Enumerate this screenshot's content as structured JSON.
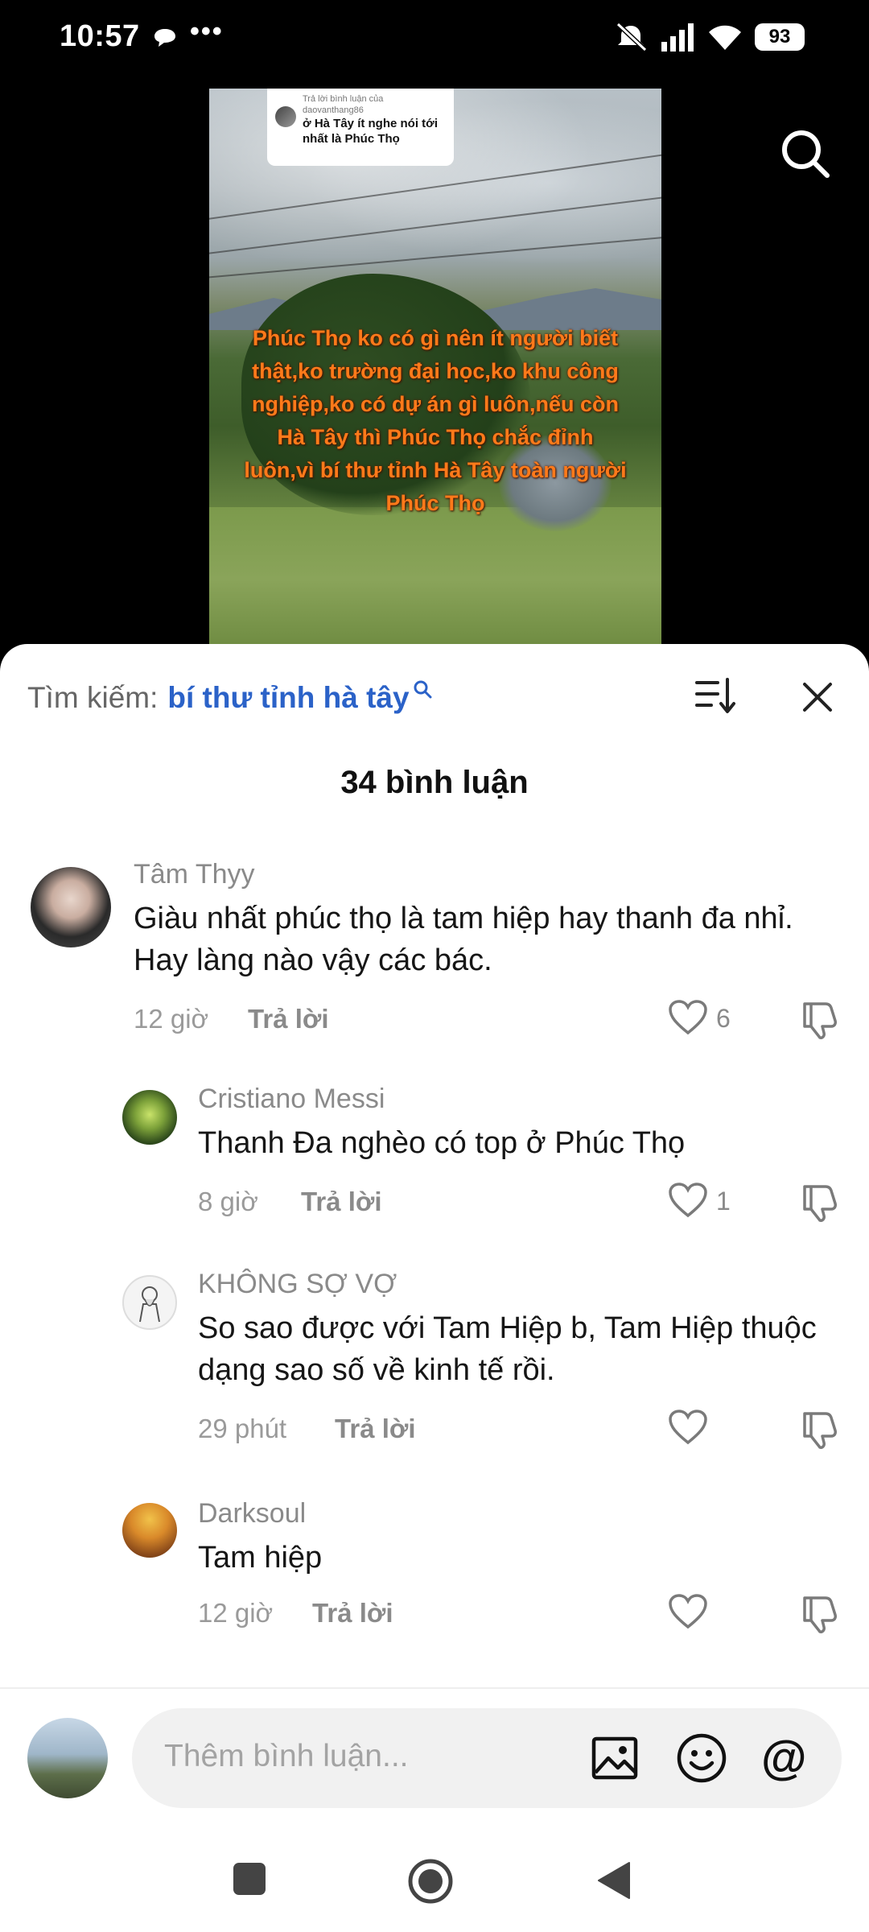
{
  "status_bar": {
    "time": "10:57",
    "more": "•••",
    "battery": "93"
  },
  "video": {
    "reply_label": "Trả lời bình luận của daovanthang86",
    "reply_text": "ở Hà Tây ít nghe nói tới nhất là Phúc Thọ",
    "caption": "Phúc Thọ ko có gì nên ít người biết thật,ko trường đại học,ko khu công nghiệp,ko có dự án gì luôn,nếu còn Hà Tây thì Phúc Thọ chắc đỉnh luôn,vì bí thư tỉnh Hà Tây toàn người Phúc Thọ"
  },
  "sheet": {
    "search_prefix": "Tìm kiếm:",
    "search_keyword": "bí thư tỉnh hà tây",
    "count_label": "34 bình luận"
  },
  "comments": [
    {
      "name": "Tâm Thyy",
      "text": "Giàu nhất phúc thọ là tam hiệp hay thanh đa nhỉ. Hay làng nào vậy các bác.",
      "time": "12 giờ",
      "reply": "Trả lời",
      "likes": "6"
    },
    {
      "name": "Cristiano Messi",
      "text": "Thanh Đa nghèo có top ở Phúc Thọ",
      "time": "8 giờ",
      "reply": "Trả lời",
      "likes": "1"
    },
    {
      "name": "KHÔNG SỢ VỢ",
      "text": "So sao được với Tam Hiệp b, Tam Hiệp thuộc dạng sao số về kinh tế rồi.",
      "time": "29 phút",
      "reply": "Trả lời",
      "likes": ""
    },
    {
      "name": "Darksoul",
      "text": "Tam hiệp",
      "time": "12 giờ",
      "reply": "Trả lời",
      "likes": ""
    }
  ],
  "compose": {
    "placeholder": "Thêm bình luận...",
    "at": "@"
  },
  "icons": [
    "chat-bubble-icon",
    "mute-icon",
    "signal-icon",
    "wifi-icon",
    "search-icon",
    "sort-icon",
    "close-icon",
    "heart-icon",
    "dislike-icon",
    "image-icon",
    "emoji-icon",
    "square-nav-icon",
    "home-nav-icon",
    "back-nav-icon"
  ]
}
